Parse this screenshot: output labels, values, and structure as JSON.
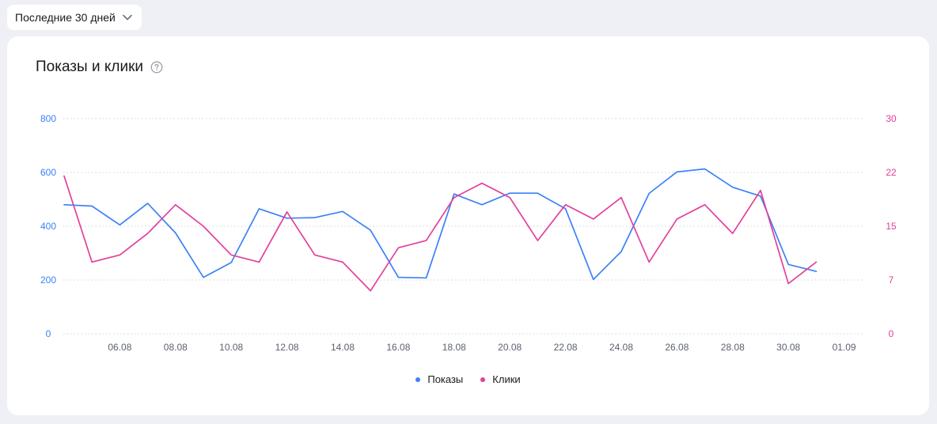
{
  "filter": {
    "period_label": "Последние 30 дней",
    "chevron_icon": "chevron-down-icon"
  },
  "card": {
    "title": "Показы и клики",
    "help_icon": "question-circle-icon"
  },
  "colors": {
    "impressions": "#3b82f6",
    "clicks": "#e2409a",
    "grid": "#cfd3dc",
    "xtick": "#5c6270"
  },
  "chart_data": {
    "type": "line",
    "title": "Показы и клики",
    "x": [
      "04.08",
      "05.08",
      "06.08",
      "07.08",
      "08.08",
      "09.08",
      "10.08",
      "11.08",
      "12.08",
      "13.08",
      "14.08",
      "15.08",
      "16.08",
      "17.08",
      "18.08",
      "19.08",
      "20.08",
      "21.08",
      "22.08",
      "23.08",
      "24.08",
      "25.08",
      "26.08",
      "27.08",
      "28.08",
      "29.08",
      "30.08",
      "31.08"
    ],
    "x_ticks": [
      "06.08",
      "08.08",
      "10.08",
      "12.08",
      "14.08",
      "16.08",
      "18.08",
      "20.08",
      "22.08",
      "24.08",
      "26.08",
      "28.08",
      "30.08",
      "01.09"
    ],
    "y_left": {
      "ticks": [
        "800",
        "600",
        "400",
        "200",
        "0"
      ],
      "ylim": [
        0,
        800
      ]
    },
    "y_right": {
      "ticks": [
        "30",
        "22",
        "15",
        "7",
        "0"
      ],
      "ylim": [
        0,
        30
      ]
    },
    "grid": true,
    "legend_position": "bottom-center",
    "series": [
      {
        "name": "Показы",
        "axis": "left",
        "values": [
          480,
          475,
          405,
          485,
          375,
          210,
          265,
          465,
          430,
          432,
          455,
          385,
          210,
          208,
          520,
          480,
          523,
          523,
          465,
          202,
          306,
          522,
          602,
          613,
          545,
          512,
          258,
          232
        ]
      },
      {
        "name": "Клики",
        "axis": "right",
        "values": [
          22,
          10,
          11,
          14,
          18,
          15,
          11,
          10,
          17,
          11,
          10,
          6,
          12,
          13,
          19,
          21,
          19,
          13,
          18,
          16,
          19,
          10,
          16,
          18,
          14,
          20,
          7,
          10
        ]
      }
    ]
  }
}
